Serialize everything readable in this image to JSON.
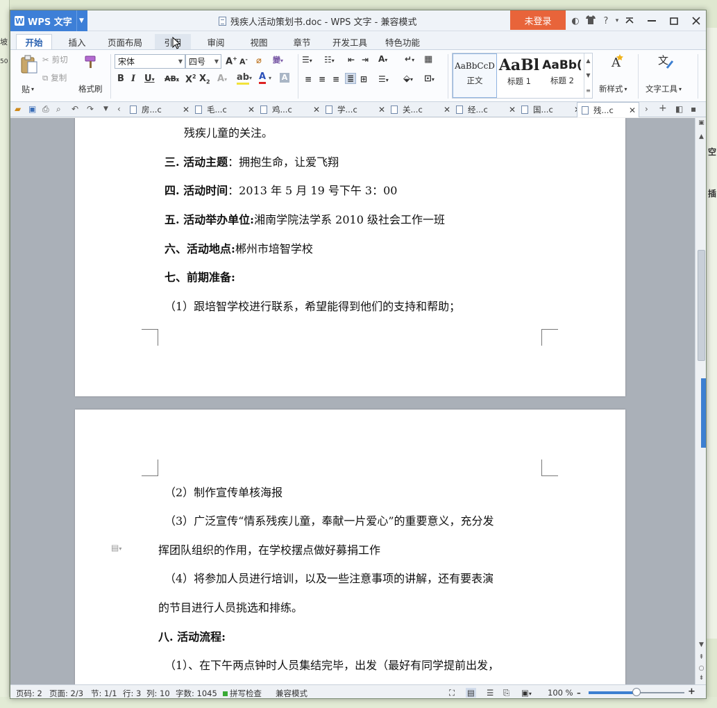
{
  "background": {
    "left_frags": [
      "坡",
      "50"
    ],
    "right_frags": [
      "空",
      "插"
    ]
  },
  "titlebar": {
    "app_name": "WPS 文字",
    "app_logo": "W",
    "doc_title": "残疾人活动策划书.doc - WPS 文字 - 兼容模式",
    "login": "未登录",
    "icons": [
      "◐",
      "♦",
      "?"
    ],
    "help_caret": "▾"
  },
  "menu": {
    "tabs": [
      "开始",
      "插入",
      "页面布局",
      "引用",
      "审阅",
      "视图",
      "章节",
      "开发工具",
      "特色功能"
    ],
    "active": "开始"
  },
  "ribbon": {
    "paste": "贴",
    "cut": "剪切",
    "copy": "复制",
    "format_painter": "格式刷",
    "font_name": "宋体",
    "font_size": "四号",
    "styles": [
      {
        "preview": "AaBbCcD",
        "label": "正文"
      },
      {
        "preview": "AaBl",
        "label": "标题 1"
      },
      {
        "preview": "AaBb(",
        "label": "标题 2"
      }
    ],
    "new_style": "新样式",
    "text_tools": "文字工具"
  },
  "doc_tabs": [
    {
      "label": "房...c"
    },
    {
      "label": "毛...c"
    },
    {
      "label": "鸡...c"
    },
    {
      "label": "学...c"
    },
    {
      "label": "关...c"
    },
    {
      "label": "经...c"
    },
    {
      "label": "国...c"
    },
    {
      "label": "残...c"
    }
  ],
  "document": {
    "page1": {
      "l0": "残疾儿童的关注。",
      "l1_b": "三. 活动主题",
      "l1": "：拥抱生命，让爱飞翔",
      "l2_b": "四. 活动时间",
      "l2": "：2013 年 5 月 19 号下午 3：00",
      "l3_b": "五. 活动举办单位:",
      "l3": "湘南学院法学系 2010 级社会工作一班",
      "l4_b": "六、活动地点:",
      "l4": "郴州市培智学校",
      "l5_b": "七、前期准备:",
      "l6": "（1）跟培智学校进行联系，希望能得到他们的支持和帮助；"
    },
    "page2": {
      "l1": "（2）制作宣传单核海报",
      "l2": "（3）广泛宣传“情系残疾儿童，奉献一片爱心”的重要意义，充分发",
      "l3": "挥团队组织的作用，在学校摆点做好募捐工作",
      "l4": "（4）将参加人员进行培训，以及一些注意事项的讲解，还有要表演",
      "l5": "的节目进行人员挑选和排练。",
      "l6_b": "八. 活动流程:",
      "l7": "（1）、在下午两点钟时人员集结完毕，出发（最好有同学提前出发，"
    }
  },
  "status": {
    "page_num": "页码: 2",
    "pages": "页面: 2/3",
    "section": "节: 1/1",
    "row": "行: 3",
    "col": "列: 10",
    "words": "字数: 1045",
    "spell": "拼写检查",
    "mode": "兼容模式",
    "zoom": "100 %",
    "zoom_level": 0.5
  }
}
